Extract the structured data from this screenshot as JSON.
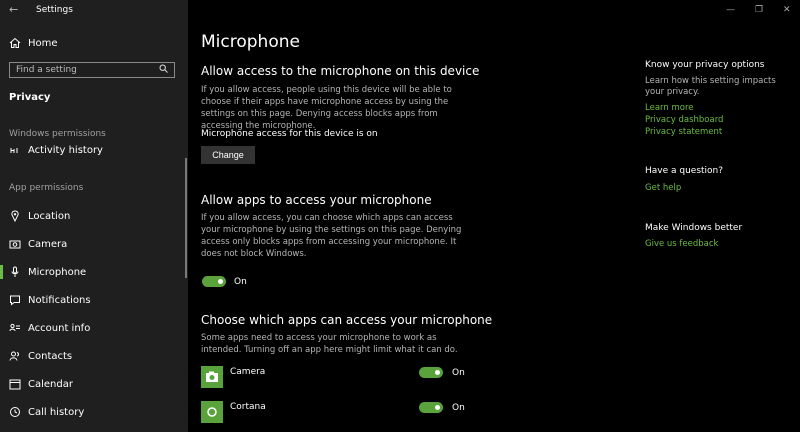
{
  "window": {
    "title": "Settings",
    "back_glyph": "←",
    "minimize": "—",
    "maximize": "❐",
    "close": "✕"
  },
  "sidebar": {
    "home_label": "Home",
    "search_placeholder": "Find a setting",
    "category": "Privacy",
    "windows_permissions_label": "Windows permissions",
    "activity_history_label": "Activity history",
    "app_permissions_label": "App permissions",
    "items": [
      {
        "label": "Location",
        "icon": "location-icon"
      },
      {
        "label": "Camera",
        "icon": "camera-icon"
      },
      {
        "label": "Microphone",
        "icon": "microphone-icon",
        "active": true
      },
      {
        "label": "Notifications",
        "icon": "notifications-icon"
      },
      {
        "label": "Account info",
        "icon": "account-info-icon"
      },
      {
        "label": "Contacts",
        "icon": "contacts-icon"
      },
      {
        "label": "Calendar",
        "icon": "calendar-icon"
      },
      {
        "label": "Call history",
        "icon": "call-history-icon"
      }
    ]
  },
  "main": {
    "title": "Microphone",
    "device_section": {
      "heading": "Allow access to the microphone on this device",
      "description": "If you allow access, people using this device will be able to choose if their apps have microphone access by using the settings on this page. Denying access blocks apps from accessing the microphone.",
      "status": "Microphone access for this device is on",
      "change_button": "Change"
    },
    "apps_section": {
      "heading": "Allow apps to access your microphone",
      "description": "If you allow access, you can choose which apps can access your microphone by using the settings on this page. Denying access only blocks apps from accessing your microphone. It does not block Windows.",
      "toggle_state": "On"
    },
    "choose_section": {
      "heading": "Choose which apps can access your microphone",
      "description": "Some apps need to access your microphone to work as intended. Turning off an app here might limit what it can do.",
      "apps": [
        {
          "name": "Camera",
          "state": "On",
          "icon": "camera-app-icon"
        },
        {
          "name": "Cortana",
          "state": "On",
          "icon": "cortana-app-icon"
        }
      ]
    }
  },
  "right_panel": {
    "privacy_heading": "Know your privacy options",
    "privacy_text": "Learn how this setting impacts your privacy.",
    "links": [
      "Learn more",
      "Privacy dashboard",
      "Privacy statement"
    ],
    "question_heading": "Have a question?",
    "get_help": "Get help",
    "better_heading": "Make Windows better",
    "feedback": "Give us feedback"
  },
  "colors": {
    "accent": "#5aa33c",
    "link": "#6bbd45",
    "sidebar_bg": "#1f1f1f",
    "bg": "#000000"
  }
}
